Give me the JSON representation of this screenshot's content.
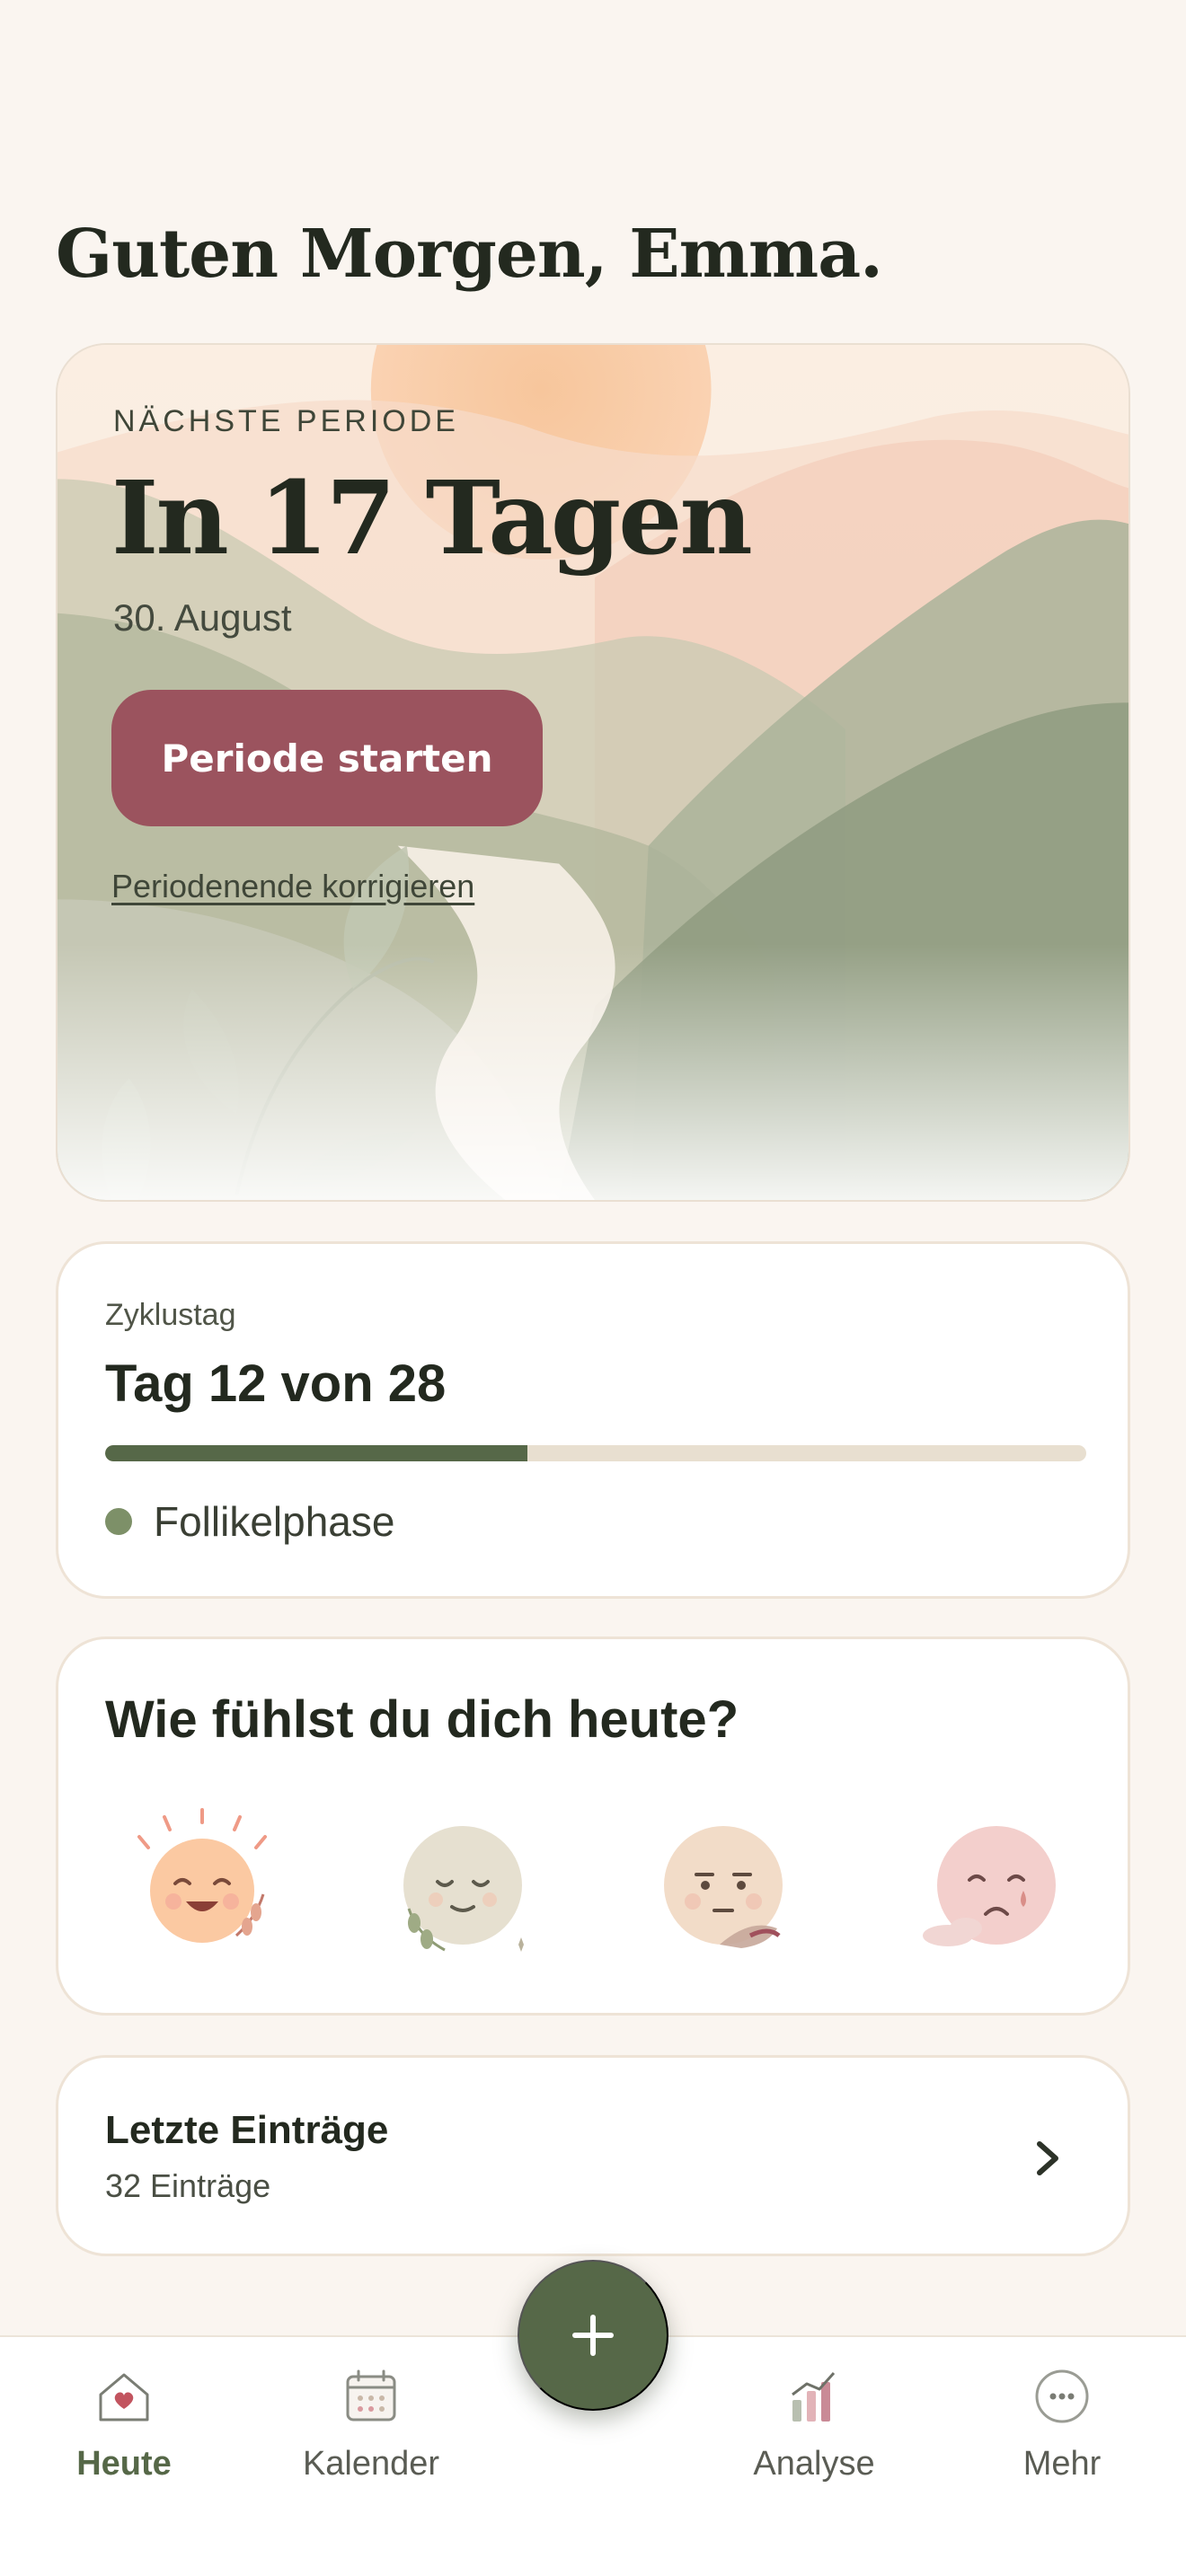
{
  "greeting": "Guten Morgen, Emma.",
  "hero": {
    "eyebrow": "NÄCHSTE PERIODE",
    "headline": "In 17 Tagen",
    "date": "30. August",
    "start_button": "Periode starten",
    "correct_link": "Periodenende korrigieren"
  },
  "cycle": {
    "label": "Zyklustag",
    "value": "Tag 12 von 28",
    "progress": 0.43,
    "phase": "Follikelphase"
  },
  "mood": {
    "title": "Wie fühlst du dich heute?",
    "options": [
      "happy-face-icon",
      "calm-face-icon",
      "neutral-face-icon",
      "sad-face-icon"
    ]
  },
  "entries": {
    "title": "Letzte Einträge",
    "count": "32 Einträge"
  },
  "tabs": [
    {
      "label": "Heute",
      "icon": "home-heart-icon",
      "active": true
    },
    {
      "label": "Kalender",
      "icon": "calendar-icon",
      "active": false
    },
    {
      "label": "Analyse",
      "icon": "chart-icon",
      "active": false
    },
    {
      "label": "Mehr",
      "icon": "more-icon",
      "active": false
    }
  ],
  "fab": {
    "icon": "plus-icon"
  },
  "colors": {
    "background": "#faf5f0",
    "accent_green": "#566848",
    "button_rose": "#9b535e",
    "phase_dot": "#7d9068"
  }
}
